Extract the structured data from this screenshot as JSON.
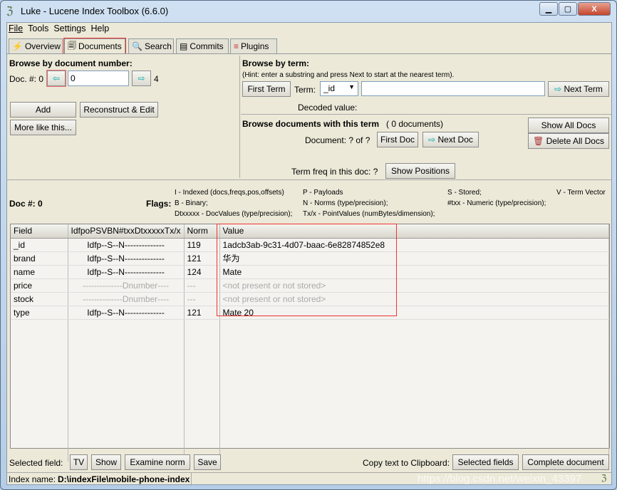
{
  "window": {
    "title": "Luke - Lucene Index Toolbox (6.6.0)"
  },
  "menu": [
    "File",
    "Tools",
    "Settings",
    "Help"
  ],
  "tabs": [
    {
      "label": "Overview",
      "icon": "overview-icon"
    },
    {
      "label": "Documents",
      "icon": "documents-icon",
      "selected": true
    },
    {
      "label": "Search",
      "icon": "search-icon"
    },
    {
      "label": "Commits",
      "icon": "commits-icon"
    },
    {
      "label": "Plugins",
      "icon": "plugins-icon"
    }
  ],
  "browse_doc": {
    "heading": "Browse by document number:",
    "doc_label": "Doc. #: 0",
    "doc_value": "0",
    "max": "4",
    "add": "Add",
    "reconstruct": "Reconstruct & Edit",
    "more_like": "More like this..."
  },
  "browse_term": {
    "heading": "Browse by term:",
    "hint": "(Hint: enter a substring and press Next to start at the nearest term).",
    "first_term": "First Term",
    "term_label": "Term:",
    "term_field": "_id",
    "next_term": "Next Term",
    "decoded": "Decoded value:"
  },
  "browse_docs_term": {
    "heading": "Browse documents with this term",
    "count": "( 0 documents)",
    "document_label": "Document: ?  of ?",
    "first_doc": "First Doc",
    "next_doc": "Next Doc",
    "show_all": "Show All Docs",
    "delete_all": "Delete All Docs",
    "term_freq": "Term freq in this doc: ?",
    "show_positions": "Show Positions"
  },
  "flags": {
    "doc": "Doc #: 0",
    "label": "Flags:",
    "items": [
      "I - Indexed (docs,freqs,pos,offsets)",
      "P - Payloads",
      "S - Stored;",
      "V - Term Vector",
      "B - Binary;",
      "N - Norms (type/precision);",
      "#txx - Numeric (type/precision);",
      "Dtxxxxx - DocValues (type/precision);",
      "Tx/x - PointValues (numBytes/dimension);"
    ]
  },
  "table": {
    "headers": [
      "Field",
      "IdfpoPSVBN#txxDtxxxxxTx/x",
      "Norm",
      "Value"
    ],
    "rows": [
      [
        "_id",
        "Idfp--S--N--------------",
        "119",
        "1adcb3ab-9c31-4d07-baac-6e82874852e8"
      ],
      [
        "brand",
        "Idfp--S--N--------------",
        "121",
        "华为"
      ],
      [
        "name",
        "Idfp--S--N--------------",
        "124",
        "Mate"
      ],
      [
        "price",
        "--------------Dnumber----",
        "---",
        "<not present or not stored>"
      ],
      [
        "stock",
        "--------------Dnumber----",
        "---",
        "<not present or not stored>"
      ],
      [
        "type",
        "Idfp--S--N--------------",
        "121",
        "Mate 20"
      ]
    ]
  },
  "bottom": {
    "selected_field": "Selected field:",
    "tv": "TV",
    "show": "Show",
    "examine_norm": "Examine norm",
    "save": "Save",
    "copy_label": "Copy text to Clipboard:",
    "selected_fields": "Selected fields",
    "complete_document": "Complete document"
  },
  "status": {
    "label": "Index name:",
    "value": "D:\\indexFile\\mobile-phone-index",
    "watermark": "https://blog.csdn.net/weixin_43397"
  }
}
